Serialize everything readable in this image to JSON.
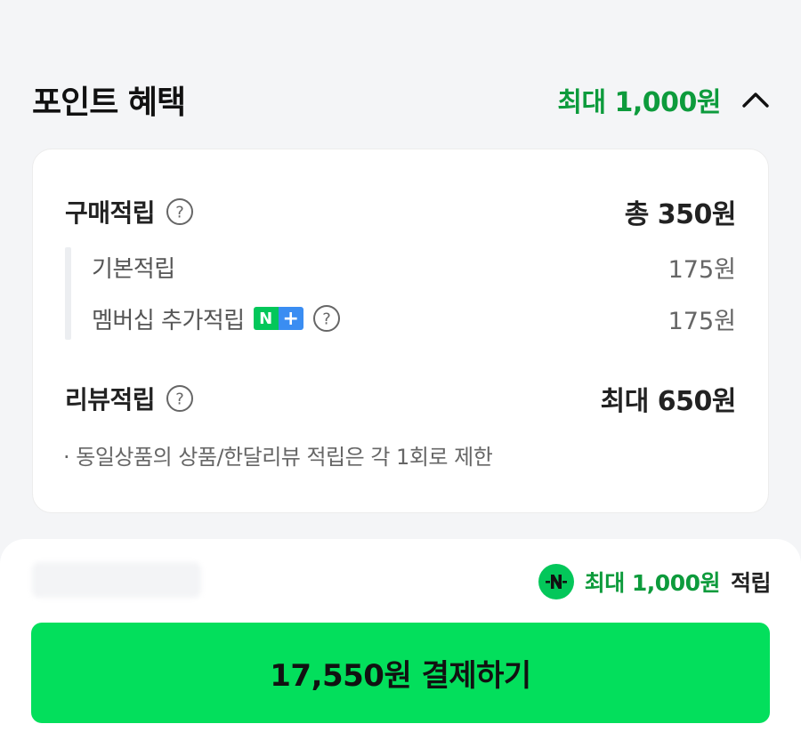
{
  "section": {
    "title": "포인트 혜택",
    "max_benefit": "최대 1,000원",
    "chevron_icon": "chevron-up-icon"
  },
  "purchase_points": {
    "label": "구매적립",
    "total": "총 350원",
    "help_icon": "question-circle-icon",
    "items": [
      {
        "label": "기본적립",
        "value": "175원"
      },
      {
        "label": "멤버십 추가적립",
        "value": "175원",
        "badge": {
          "n": "N",
          "plus": "+"
        }
      }
    ]
  },
  "review_points": {
    "label": "리뷰적립",
    "value": "최대 650원",
    "help_icon": "question-circle-icon",
    "note": "· 동일상품의 상품/한달리뷰 적립은 각 1회로 제한"
  },
  "bottom": {
    "reward_icon": "naver-pay-icon",
    "reward_amount": "최대 1,000원",
    "reward_suffix": "적립",
    "pay_button_label": "17,550원 결제하기"
  },
  "colors": {
    "accent_green": "#0d9b3c",
    "naver_green": "#03c75a",
    "button_green": "#03df5c",
    "badge_blue": "#3a8df2",
    "background": "#f4f5f7"
  }
}
